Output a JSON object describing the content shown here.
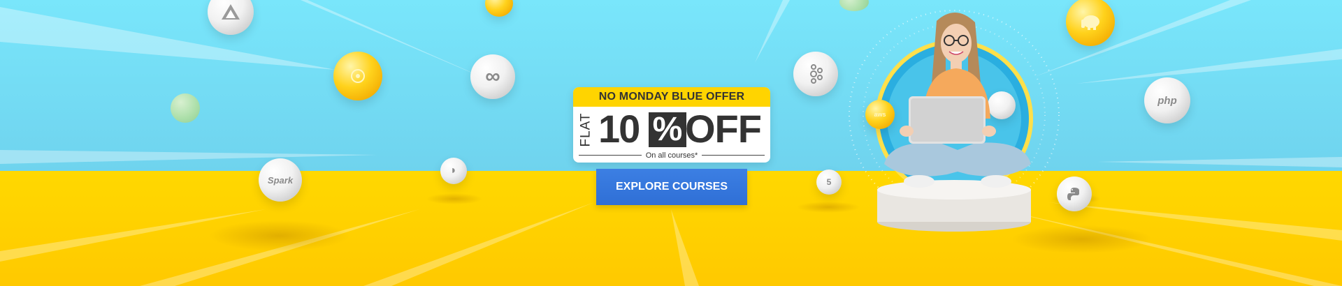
{
  "offer": {
    "title": "NO MONDAY BLUE  OFFER",
    "flat": "FLAT",
    "percent_number": "10",
    "percent_symbol": "%",
    "off": "OFF",
    "subtitle": "On all courses*"
  },
  "cta": {
    "label": "EXPLORE COURSES"
  },
  "logos": {
    "spark": "Spark",
    "php": "php"
  },
  "colors": {
    "sky": "#79e3f6",
    "ground": "#ffd400",
    "header": "#ffd400",
    "cta": "#2f6fd6",
    "text": "#333333"
  },
  "icons": [
    "azure-icon",
    "kubernetes-helm-icon",
    "hadoop-elephant-icon",
    "spark-icon",
    "mysql-dolphin-icon",
    "infinity-icon",
    "html5-icon",
    "php-icon",
    "python-icon",
    "aws-icon",
    "kafka-icon"
  ]
}
